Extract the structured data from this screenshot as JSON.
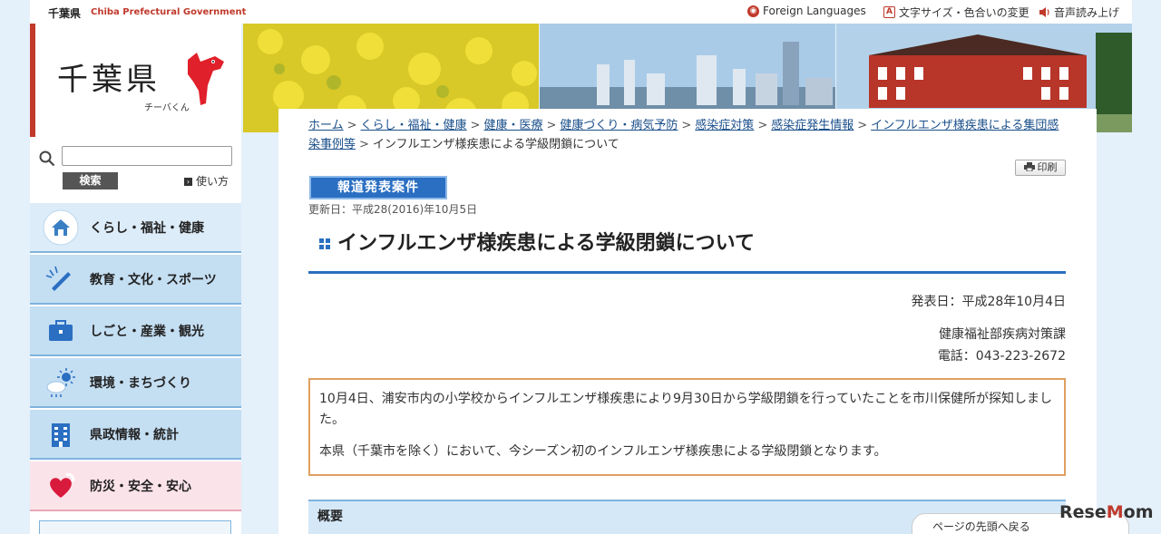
{
  "header": {
    "site_name": "千葉県",
    "site_name_en": "Chiba Prefectural Government",
    "utils": [
      {
        "label": "Foreign Languages",
        "icon": "globe-icon"
      },
      {
        "label": "文字サイズ・色合いの変更",
        "icon": "font-size-icon"
      },
      {
        "label": "音声読み上げ",
        "icon": "speaker-icon"
      }
    ]
  },
  "logo": {
    "title": "千葉県",
    "mascot_caption": "チーバくん"
  },
  "search": {
    "button": "検索",
    "howto": "使い方",
    "placeholder": ""
  },
  "nav": {
    "items": [
      {
        "label": "くらし・福祉・健康",
        "icon": "house-icon"
      },
      {
        "label": "教育・文化・スポーツ",
        "icon": "pen-icon"
      },
      {
        "label": "しごと・産業・観光",
        "icon": "briefcase-icon"
      },
      {
        "label": "環境・まちづくり",
        "icon": "weather-icon"
      },
      {
        "label": "県政情報・統計",
        "icon": "building-icon"
      },
      {
        "label": "防災・安全・安心",
        "icon": "heart-icon"
      }
    ]
  },
  "breadcrumb": {
    "links": [
      "ホーム",
      "くらし・福祉・健康",
      "健康・医療",
      "健康づくり・病気予防",
      "感染症対策",
      "感染症発生情報",
      "インフルエンザ様疾患による集団感染事例等"
    ],
    "current": "インフルエンザ様疾患による学級閉鎖について",
    "separator": ">"
  },
  "toolbar": {
    "print_label": "印刷"
  },
  "article": {
    "tag": "報道発表案件",
    "updated": "更新日：平成28(2016)年10月5日",
    "title": "インフルエンザ様疾患による学級閉鎖について",
    "release_date": "発表日：平成28年10月4日",
    "department": "健康福祉部疾病対策課",
    "phone": "電話：043-223-2672",
    "notice_p1": "10月4日、浦安市内の小学校からインフルエンザ様疾患により9月30日から学級閉鎖を行っていたことを市川保健所が探知しました。",
    "notice_p2": "本県（千葉市を除く）において、今シーズン初のインフルエンザ様疾患による学級閉鎖となります。",
    "summary_heading": "概要"
  },
  "footer": {
    "to_top": "ページの先頭へ戻る"
  },
  "watermark": {
    "text_a": "Rese",
    "text_b": "M",
    "text_c": "om"
  },
  "colors": {
    "accent": "#c0392b",
    "primary": "#2a6fc2",
    "background": "#e4f0fa",
    "notice_border": "#e0a060"
  }
}
